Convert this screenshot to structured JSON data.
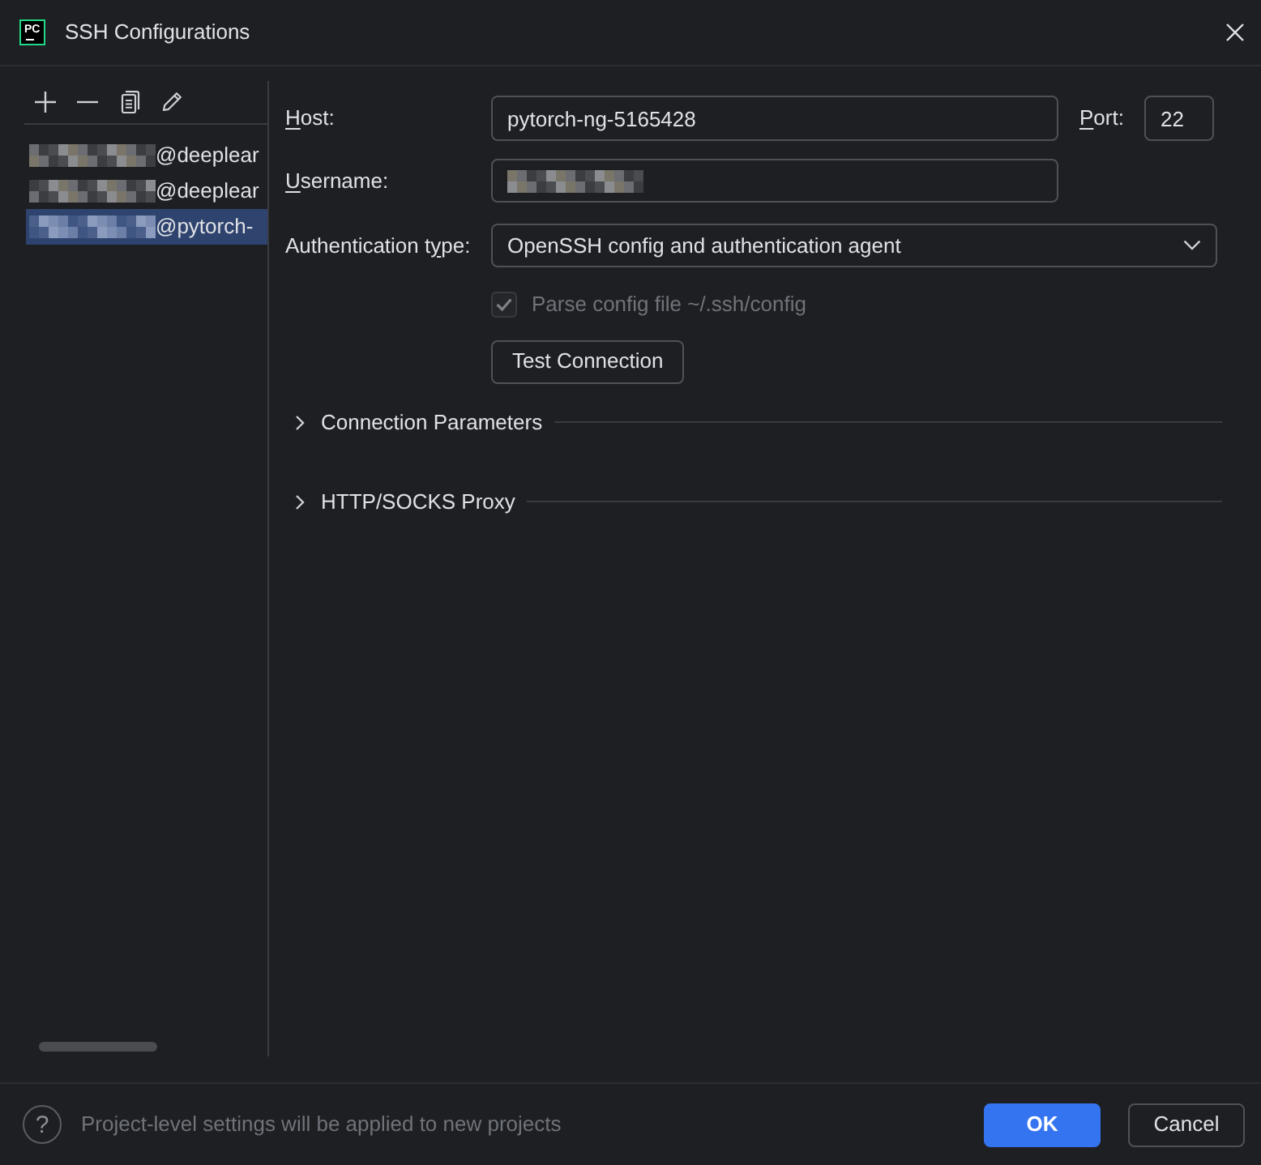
{
  "window": {
    "title": "SSH Configurations",
    "app_icon": "PC"
  },
  "toolbar": [
    {
      "kind": "add"
    },
    {
      "kind": "remove"
    },
    {
      "kind": "copy"
    },
    {
      "kind": "edit"
    }
  ],
  "hosts": [
    {
      "redacted": true,
      "text": "@deeplear",
      "selected": false
    },
    {
      "redacted": true,
      "text": "@deeplear",
      "selected": false
    },
    {
      "redacted": true,
      "text": "@pytorch-",
      "selected": true
    }
  ],
  "form": {
    "host": {
      "label": [
        {
          "text": "H",
          "underlined": true
        },
        {
          "text": "ost:",
          "underlined": false
        }
      ],
      "value": "pytorch-ng-5165428"
    },
    "port": {
      "label": [
        {
          "text": "P",
          "underlined": true
        },
        {
          "text": "ort:",
          "underlined": false
        }
      ],
      "value": "22"
    },
    "username": {
      "label": [
        {
          "text": "U",
          "underlined": true
        },
        {
          "text": "sername:",
          "underlined": false
        }
      ],
      "redacted": true
    },
    "auth_type": {
      "label": [
        {
          "text": "Authentication t",
          "underlined": false
        },
        {
          "text": "y",
          "underlined": true
        },
        {
          "text": "pe:",
          "underlined": false
        }
      ],
      "value": "OpenSSH config and authentication agent"
    },
    "parse_config": {
      "label": "Parse config file ~/.ssh/config",
      "checked": true,
      "disabled": true
    },
    "test_button": "Test Connection"
  },
  "sections": [
    {
      "title": "Connection Parameters",
      "expanded": false
    },
    {
      "title": "HTTP/SOCKS Proxy",
      "expanded": false
    }
  ],
  "footer": {
    "help": "?",
    "note": "Project-level settings will be applied to new projects",
    "buttons": [
      {
        "label": "OK",
        "kind": "primary"
      },
      {
        "label": "Cancel",
        "kind": "secondary"
      }
    ]
  }
}
